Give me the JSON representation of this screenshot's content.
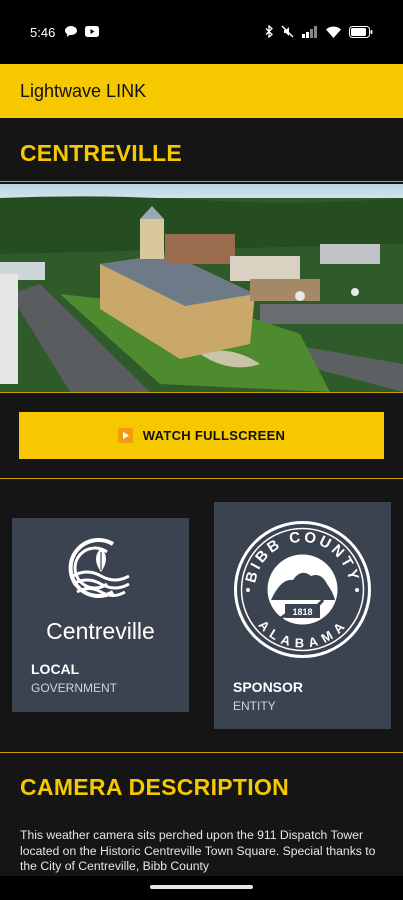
{
  "status_bar": {
    "time": "5:46",
    "left_icons": [
      "chat-bubble-icon",
      "youtube-icon"
    ],
    "right_icons": [
      "bluetooth-icon",
      "mute-icon",
      "signal-icon",
      "wifi-icon",
      "battery-icon"
    ]
  },
  "app_bar": {
    "title": "Lightwave LINK"
  },
  "camera": {
    "city": "CENTREVILLE",
    "image_alt": "Aerial view of Centreville town square and courthouse",
    "watch_label": "WATCH FULLSCREEN"
  },
  "partners": [
    {
      "logo_text": "Centreville",
      "kind": "LOCAL",
      "role": "GOVERNMENT"
    },
    {
      "seal_top": "BIBB COUNTY",
      "seal_bottom": "ALABAMA",
      "seal_year": "1818",
      "kind": "SPONSOR",
      "role": "ENTITY"
    }
  ],
  "description": {
    "heading": "CAMERA DESCRIPTION",
    "text": "This weather camera sits perched upon the 911 Dispatch Tower located on the Historic Centreville Town Square. Special thanks to the City of Centreville, Bibb County"
  },
  "colors": {
    "accent": "#f6c800",
    "background": "#151515",
    "card": "#3b4250"
  }
}
